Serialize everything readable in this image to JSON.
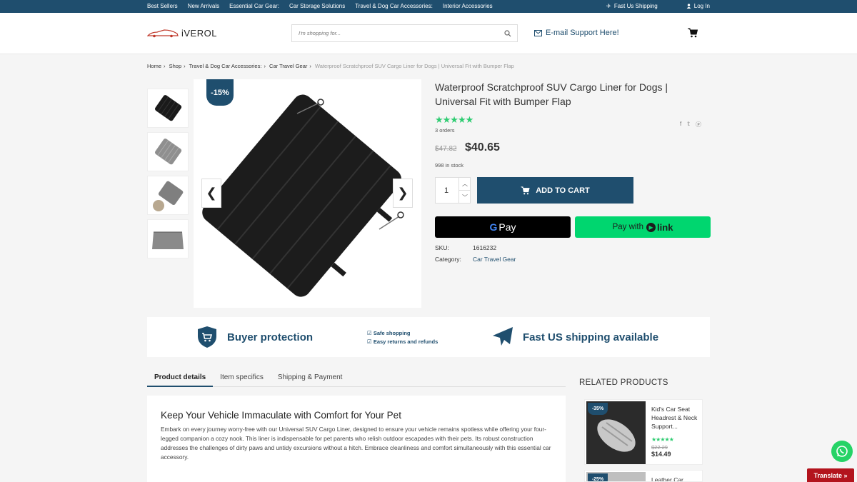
{
  "topbar": {
    "links": [
      "Best Sellers",
      "New Arrivals",
      "Essential Car Gear:",
      "Car Storage Solutions",
      "Travel & Dog Car Accessories:",
      "Interior Accessories"
    ],
    "shipping": "Fast Us Shipping",
    "login": "Log In"
  },
  "header": {
    "logo": "iVEROL",
    "search_placeholder": "I'm shopping for...",
    "email_support": "E-mail Support Here!"
  },
  "breadcrumb": {
    "items": [
      "Home",
      "Shop",
      "Travel & Dog Car Accessories:",
      "Car Travel Gear"
    ],
    "current": "Waterproof Scratchproof SUV Cargo Liner for Dogs | Universal Fit with Bumper Flap"
  },
  "product": {
    "discount_badge": "-15%",
    "title": "Waterproof Scratchproof SUV Cargo Liner for Dogs | Universal Fit with Bumper Flap",
    "stars": "★★★★★",
    "orders": "3 orders",
    "old_price": "$47.82",
    "price": "$40.65",
    "stock": "998 in stock",
    "quantity": "1",
    "add_to_cart": "ADD TO CART",
    "gpay_label": "Pay",
    "gpay_g": "G",
    "link_pay_label": "Pay with",
    "link_label": "link",
    "sku_label": "SKU:",
    "sku": "1616232",
    "category_label": "Category:",
    "category": "Car Travel Gear"
  },
  "protection": {
    "buyer": "Buyer protection",
    "safe": "Safe shopping",
    "returns": "Easy returns and refunds",
    "shipping": "Fast US shipping available"
  },
  "tabs": [
    "Product details",
    "Item specifics",
    "Shipping & Payment"
  ],
  "details": {
    "heading": "Keep Your Vehicle Immaculate with Comfort for Your Pet",
    "body": "Embark on every journey worry-free with our Universal SUV Cargo Liner, designed to ensure your vehicle remains spotless while offering your four-legged companion a cozy nook. This liner is indispensable for pet parents who relish outdoor escapades with their pets. Its robust construction addresses the challenges of dirty paws and untidy excursions without a hitch. Embrace cleanliness and comfort simultaneously with this essential car accessory."
  },
  "related": {
    "title": "RELATED PRODUCTS",
    "items": [
      {
        "badge": "-35%",
        "name": "Kid's Car Seat Headrest & Neck Support...",
        "stars": "★★★★★",
        "old_price": "$22.29",
        "price": "$14.49"
      },
      {
        "badge": "-25%",
        "name": "Leather Car"
      }
    ]
  },
  "translate": "Translate »",
  "colors": {
    "brand": "#1f4e6e",
    "rating": "#2ecc71",
    "link_pay": "#00d66f"
  }
}
